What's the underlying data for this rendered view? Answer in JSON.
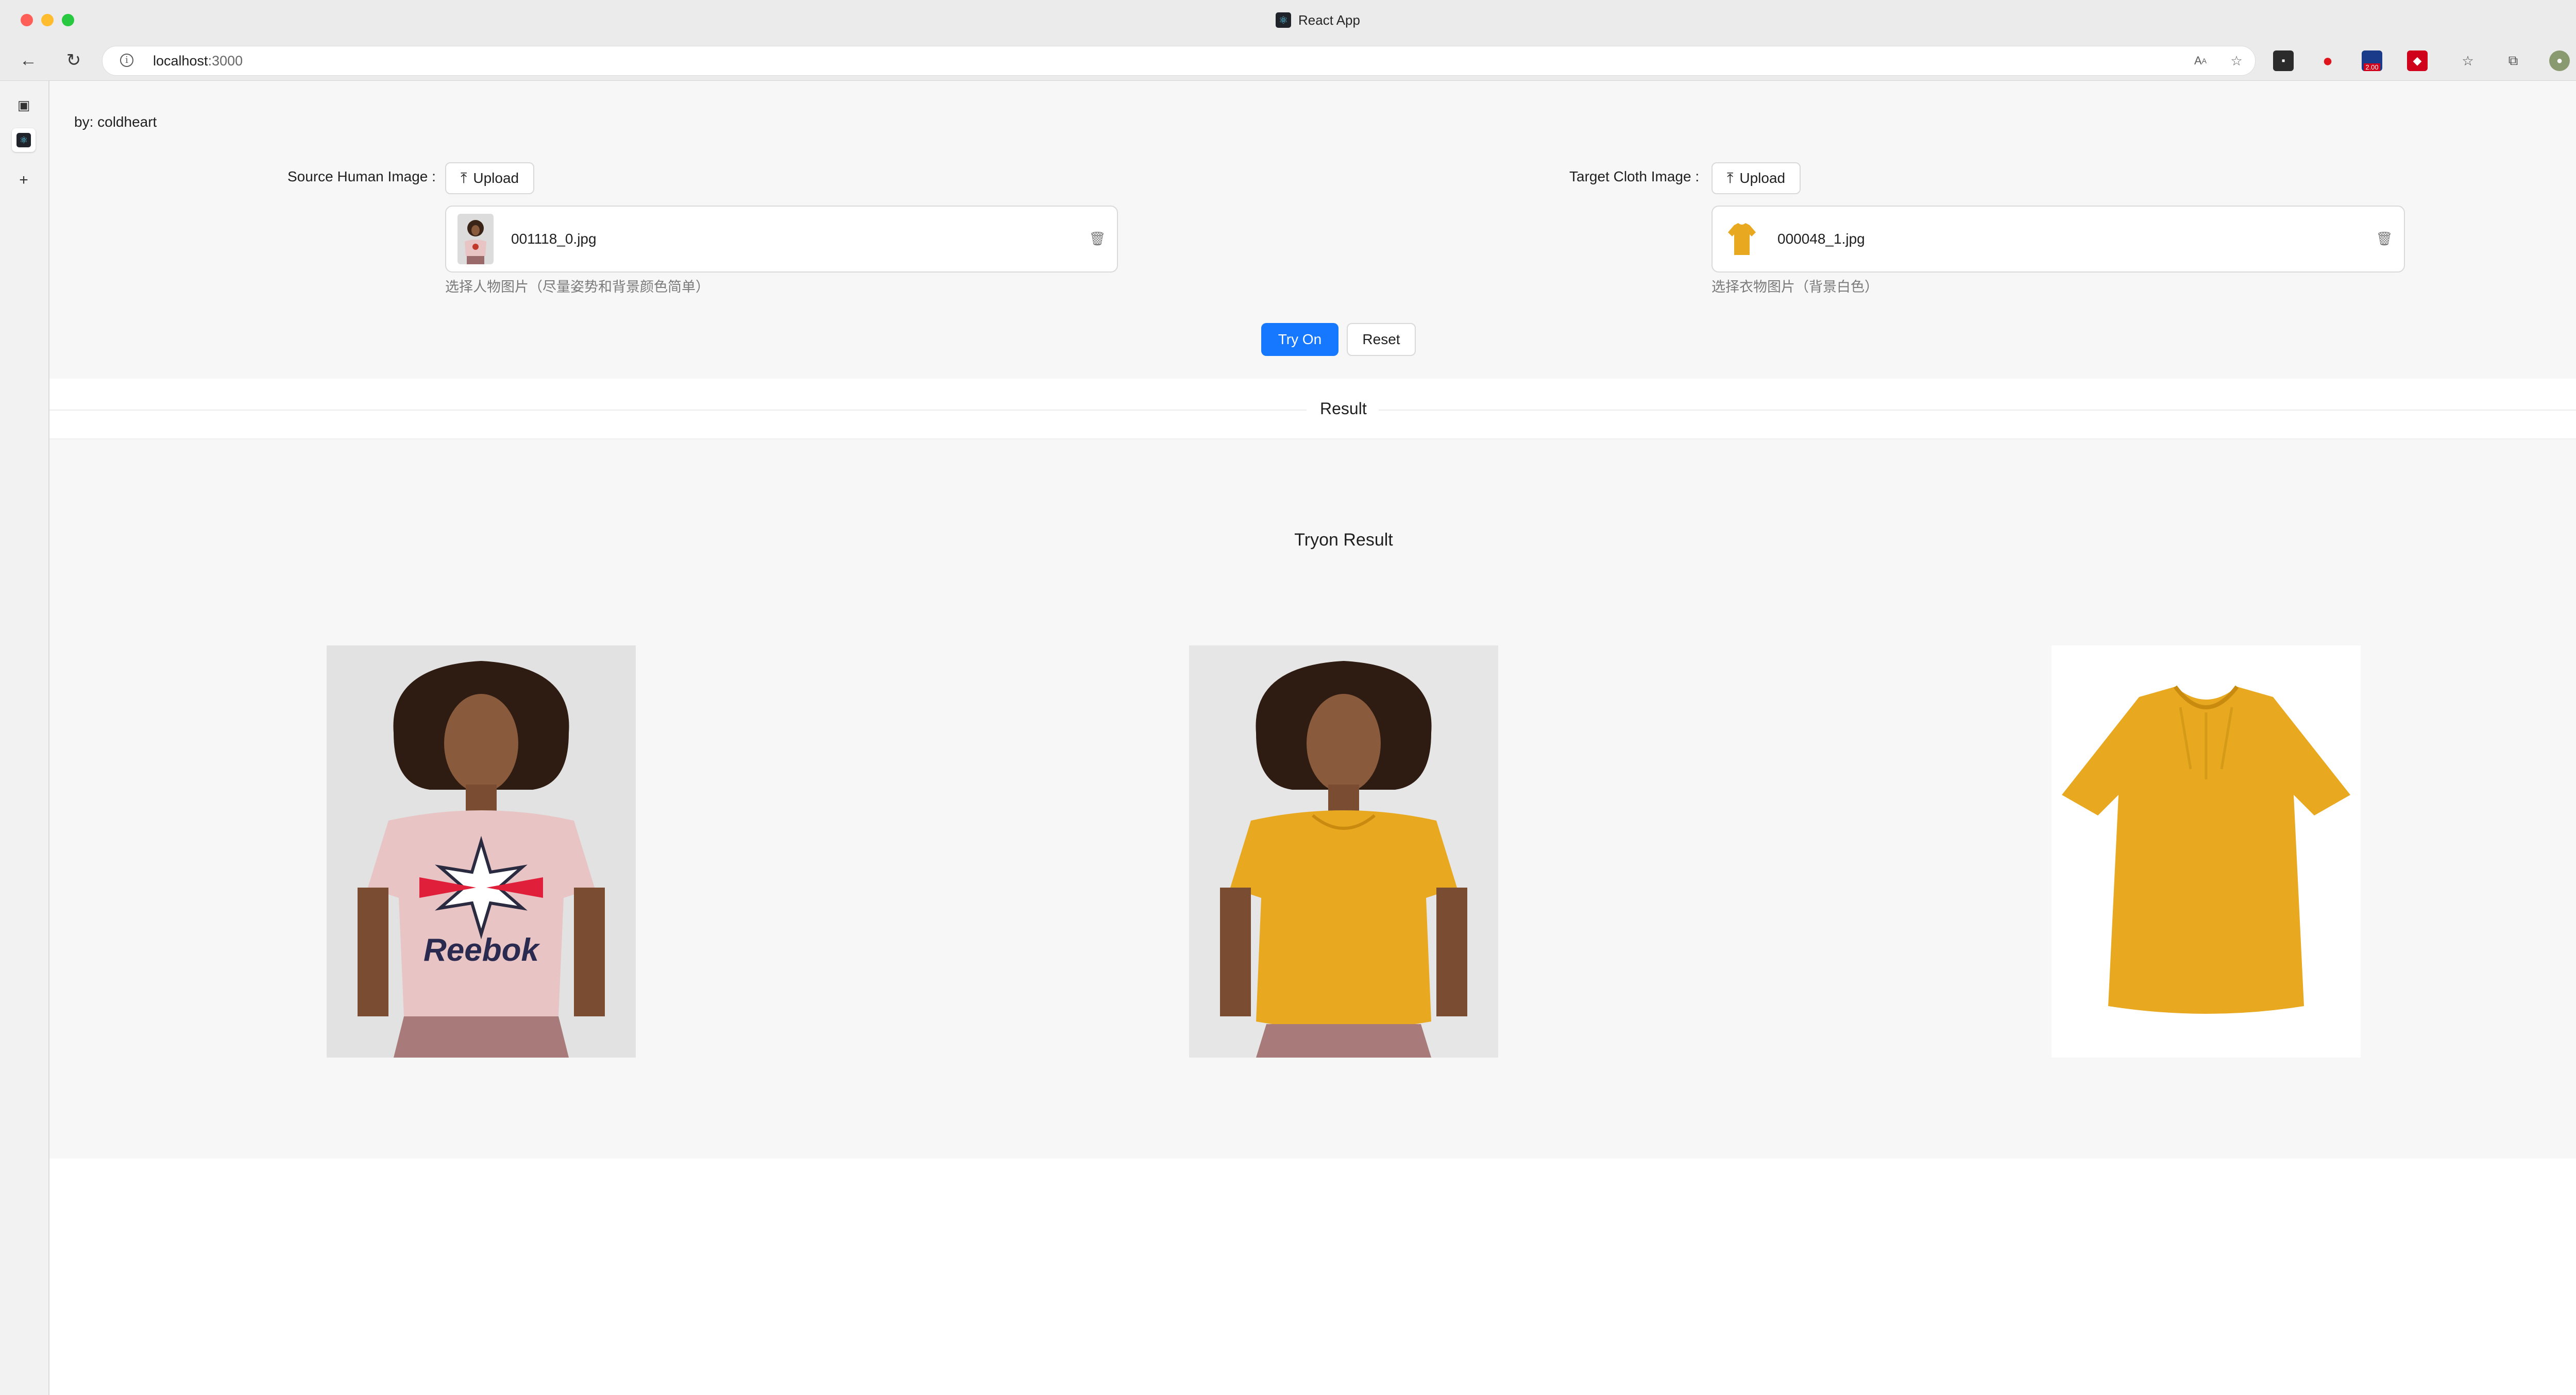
{
  "browser": {
    "tab_title": "React App",
    "url_host": "localhost",
    "url_port": ":3000",
    "icons": [
      "back-icon",
      "reload-icon",
      "info-icon",
      "read-aloud-icon",
      "favorite-add-icon",
      "extension-icon",
      "opera-icon",
      "pdf-badge-icon",
      "extension-red-icon",
      "favorites-icon",
      "collections-icon",
      "profile-avatar-icon",
      "more-icon"
    ],
    "pdf_badge_text": "2.00"
  },
  "page": {
    "by_line": "by:  coldheart",
    "source": {
      "label": "Source Human Image :",
      "upload_label": "Upload",
      "file_name": "001118_0.jpg",
      "hint": "选择人物图片（尽量姿势和背景颜色简单）"
    },
    "target": {
      "label": "Target Cloth Image :",
      "upload_label": "Upload",
      "file_name": "000048_1.jpg",
      "hint": "选择衣物图片（背景白色）"
    },
    "actions": {
      "try_on_label": "Try On",
      "reset_label": "Reset"
    },
    "result": {
      "divider_label": "Result",
      "title": "Tryon Result",
      "images": [
        "source-human-photo",
        "tryon-output-photo",
        "target-cloth-photo"
      ],
      "logo_text": "Reebok"
    }
  },
  "colors": {
    "primary": "#1677ff",
    "shirt_pink": "#e8c4c4",
    "shirt_yellow": "#e8a820"
  }
}
